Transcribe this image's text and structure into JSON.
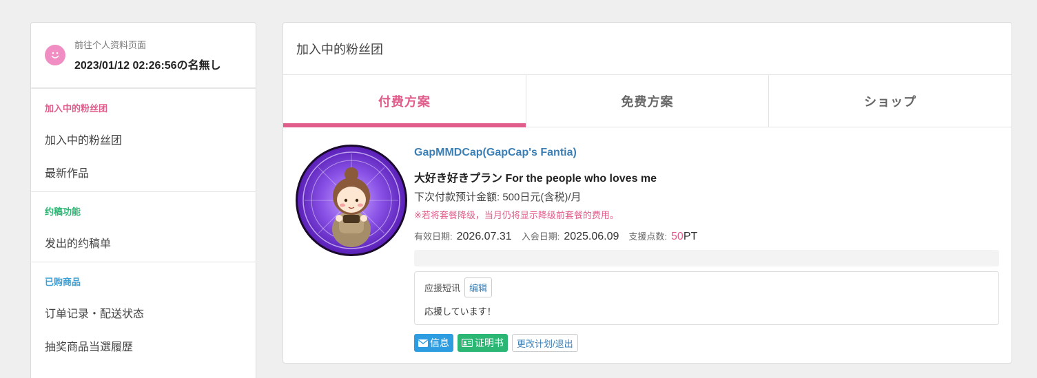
{
  "sidebar": {
    "profile_link": "前往个人资料页面",
    "profile_name": "2023/01/12 02:26:56の名無し",
    "sections": [
      {
        "heading": "加入中的粉丝团",
        "items": [
          "加入中的粉丝团",
          "最新作品"
        ]
      },
      {
        "heading": "约稿功能",
        "items": [
          "发出的约稿单"
        ]
      },
      {
        "heading": "已购商品",
        "items": [
          "订单记录・配送状态",
          "抽奖商品当選履歴"
        ]
      }
    ]
  },
  "main": {
    "title": "加入中的粉丝团",
    "tabs": [
      "付费方案",
      "免费方案",
      "ショップ"
    ],
    "active_tab": "付费方案"
  },
  "fanclub": {
    "creator": "GapMMDCap(GapCap's Fantia)",
    "plan_name": "大好き好きプラン For the people who loves me",
    "next_payment": "下次付款预计金额: 500日元(含税)/月",
    "notice": "※若将套餐降级，当月仍将显示降级前套餐的费用。",
    "valid_label": "有效日期:",
    "valid_date": "2026.07.31",
    "join_label": "入会日期:",
    "join_date": "2025.06.09",
    "points_label": "支援点数:",
    "points_value": "50",
    "points_unit": "PT",
    "message_label": "应援短讯",
    "edit_label": "编辑",
    "message_text": "応援しています！",
    "buttons": {
      "message": "信息",
      "certificate": "证明书",
      "change_plan": "更改计划/退出"
    }
  },
  "colors": {
    "accent_pink": "#e05c8a",
    "link_blue": "#3a7fb5",
    "button_blue": "#2d9ce0",
    "button_green": "#2bb673"
  }
}
